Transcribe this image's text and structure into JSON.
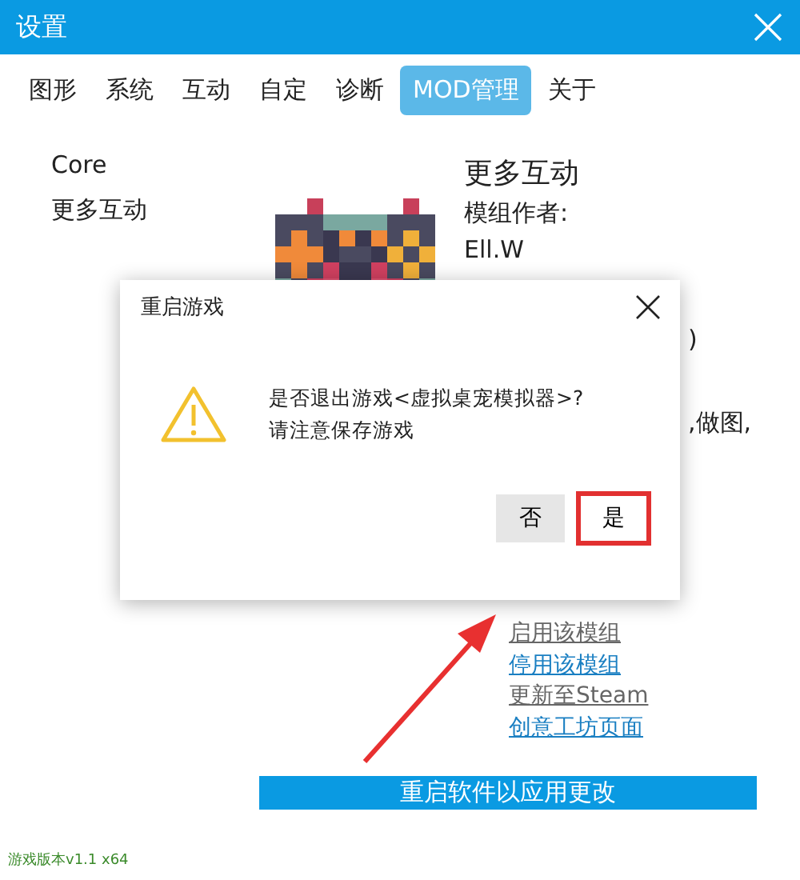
{
  "window": {
    "title": "设置"
  },
  "tabs": [
    {
      "label": "图形",
      "selected": false
    },
    {
      "label": "系统",
      "selected": false
    },
    {
      "label": "互动",
      "selected": false
    },
    {
      "label": "自定",
      "selected": false
    },
    {
      "label": "诊断",
      "selected": false
    },
    {
      "label": "MOD管理",
      "selected": true
    },
    {
      "label": "关于",
      "selected": false
    }
  ],
  "mod_list": [
    "Core",
    "更多互动"
  ],
  "mod_detail": {
    "name": "更多互动",
    "author_label": "模组作者:",
    "author": "Ell.W",
    "fragments": [
      ")",
      ",做图,"
    ]
  },
  "actions": [
    {
      "label": "启用该模组",
      "disabled": true
    },
    {
      "label": "停用该模组",
      "disabled": false
    },
    {
      "label": "更新至Steam",
      "disabled": true
    },
    {
      "label": "创意工坊页面",
      "disabled": false
    }
  ],
  "apply_button": "重启软件以应用更改",
  "version": "游戏版本v1.1 x64",
  "dialog": {
    "title": "重启游戏",
    "message": [
      "是否退出游戏<虚拟桌宠模拟器>?",
      "请注意保存游戏"
    ],
    "buttons": [
      {
        "label": "否",
        "highlighted": false
      },
      {
        "label": "是",
        "highlighted": true
      }
    ]
  }
}
